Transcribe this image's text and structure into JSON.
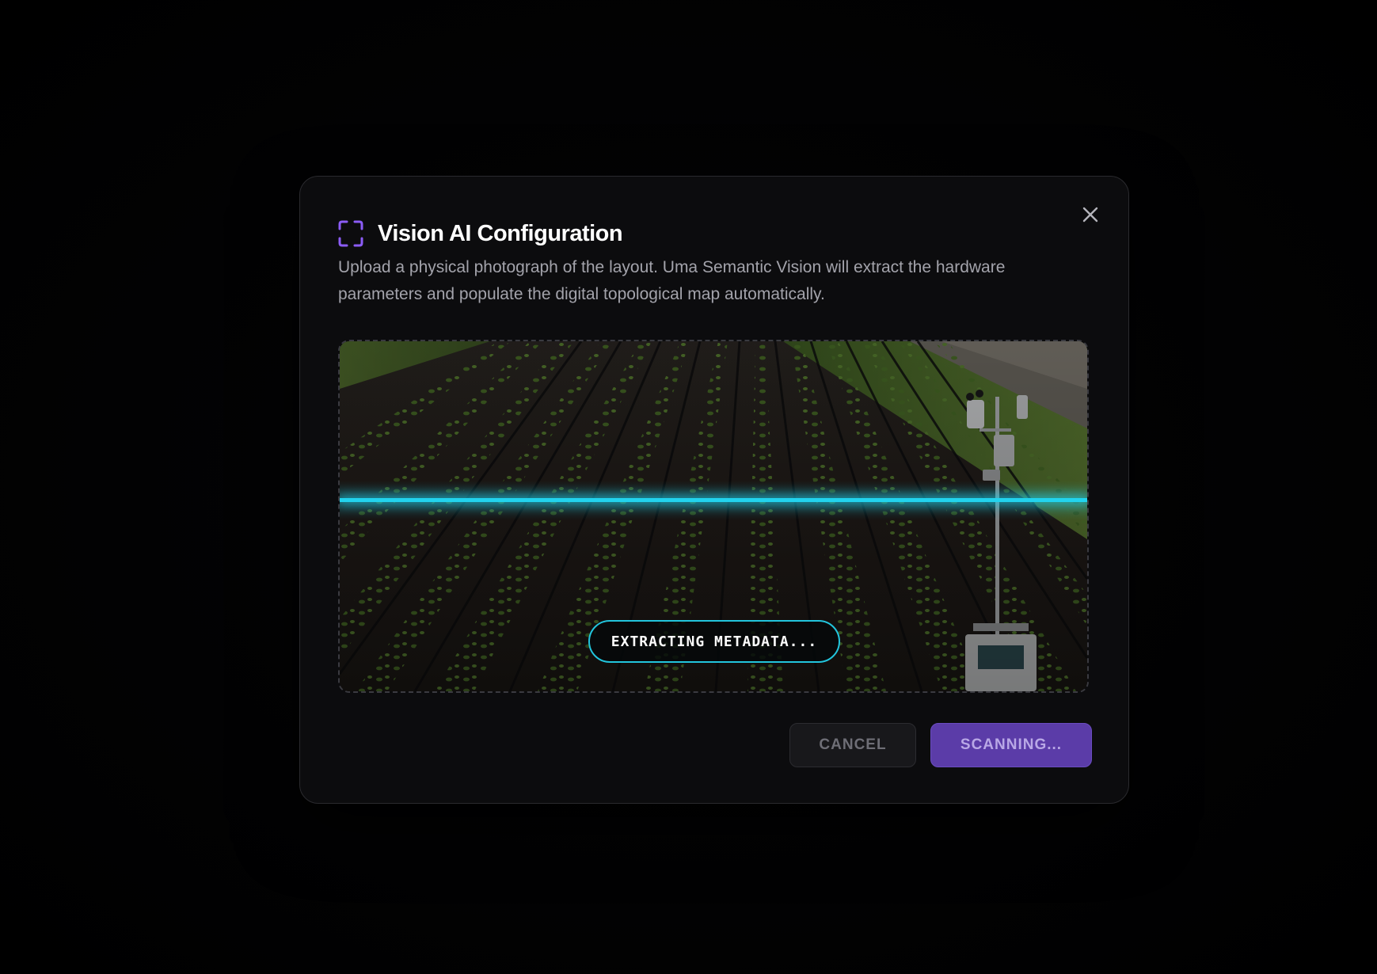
{
  "modal": {
    "title": "Vision AI Configuration",
    "description": "Upload a physical photograph of the layout. Uma Semantic Vision will extract the hardware parameters and populate the digital topological map automatically.",
    "icons": {
      "title": "scan-frame-icon",
      "close": "close-icon"
    },
    "scan": {
      "status": "EXTRACTING METADATA...",
      "accent_color": "#22d3ee"
    },
    "actions": {
      "cancel_label": "CANCEL",
      "submit_label": "SCANNING..."
    },
    "colors": {
      "brand": "#5b3ca8",
      "icon": "#8b5cf6"
    }
  }
}
